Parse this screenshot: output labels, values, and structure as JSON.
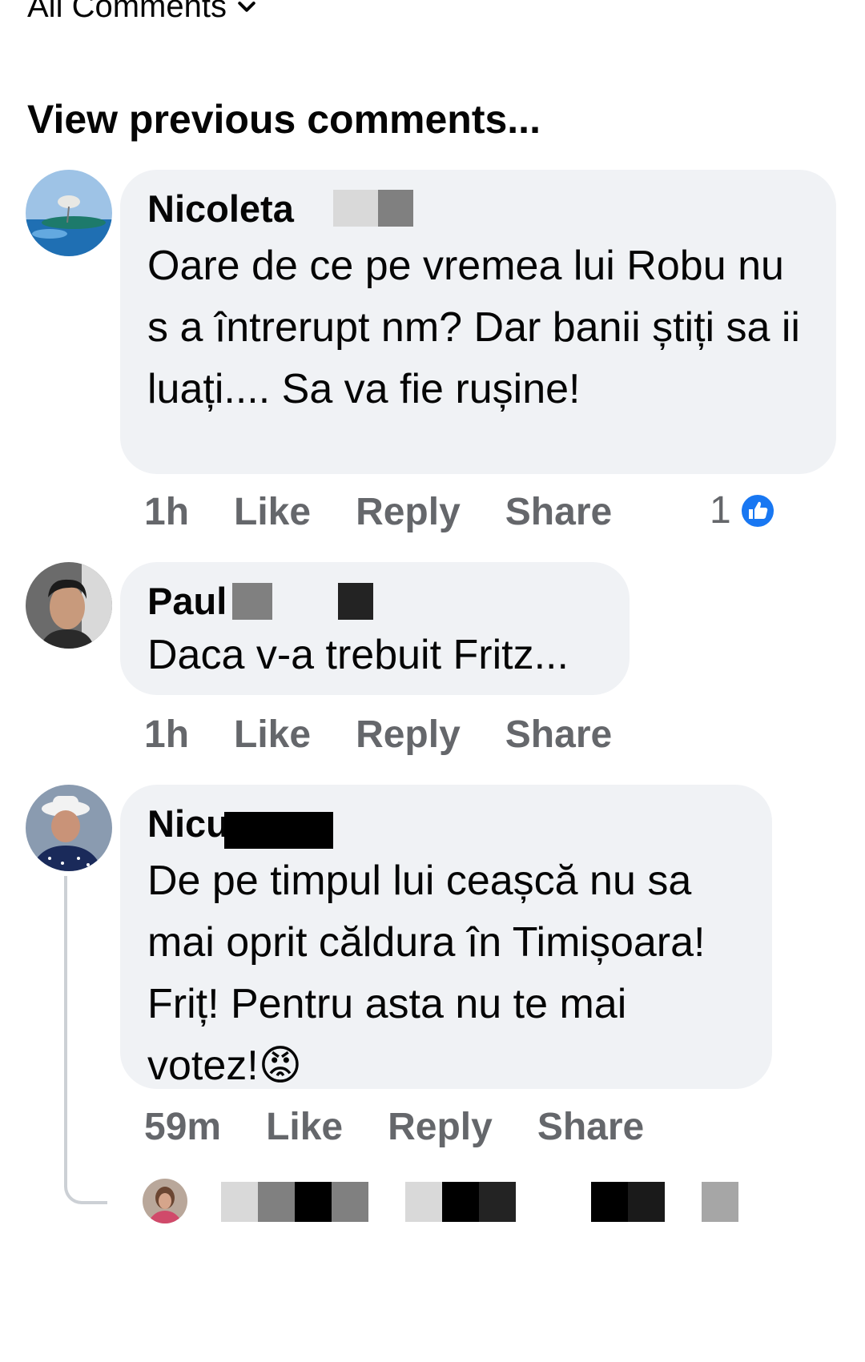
{
  "header": {
    "filter_label": "All Comments",
    "view_previous": "View previous comments..."
  },
  "comments": [
    {
      "author": "Nicoleta",
      "text": "Oare de ce pe vremea lui Robu nu s a întrerupt nm? Dar banii știți sa ii luați.... Sa va fie rușine!",
      "time": "1h",
      "like": "Like",
      "reply": "Reply",
      "share": "Share",
      "reaction_count": "1"
    },
    {
      "author": "Paul",
      "text": "Daca v-a trebuit Fritz...",
      "time": "1h",
      "like": "Like",
      "reply": "Reply",
      "share": "Share"
    },
    {
      "author": "Nicu",
      "text": "De pe timpul lui ceașcă nu sa mai oprit căldura în Timișoara! Friț! Pentru asta nu te mai votez!",
      "emoji": "😡",
      "time": "59m",
      "like": "Like",
      "reply": "Reply",
      "share": "Share"
    }
  ],
  "colors": {
    "bubble": "#f0f2f5",
    "meta": "#65676b",
    "like_blue": "#1877f2"
  }
}
